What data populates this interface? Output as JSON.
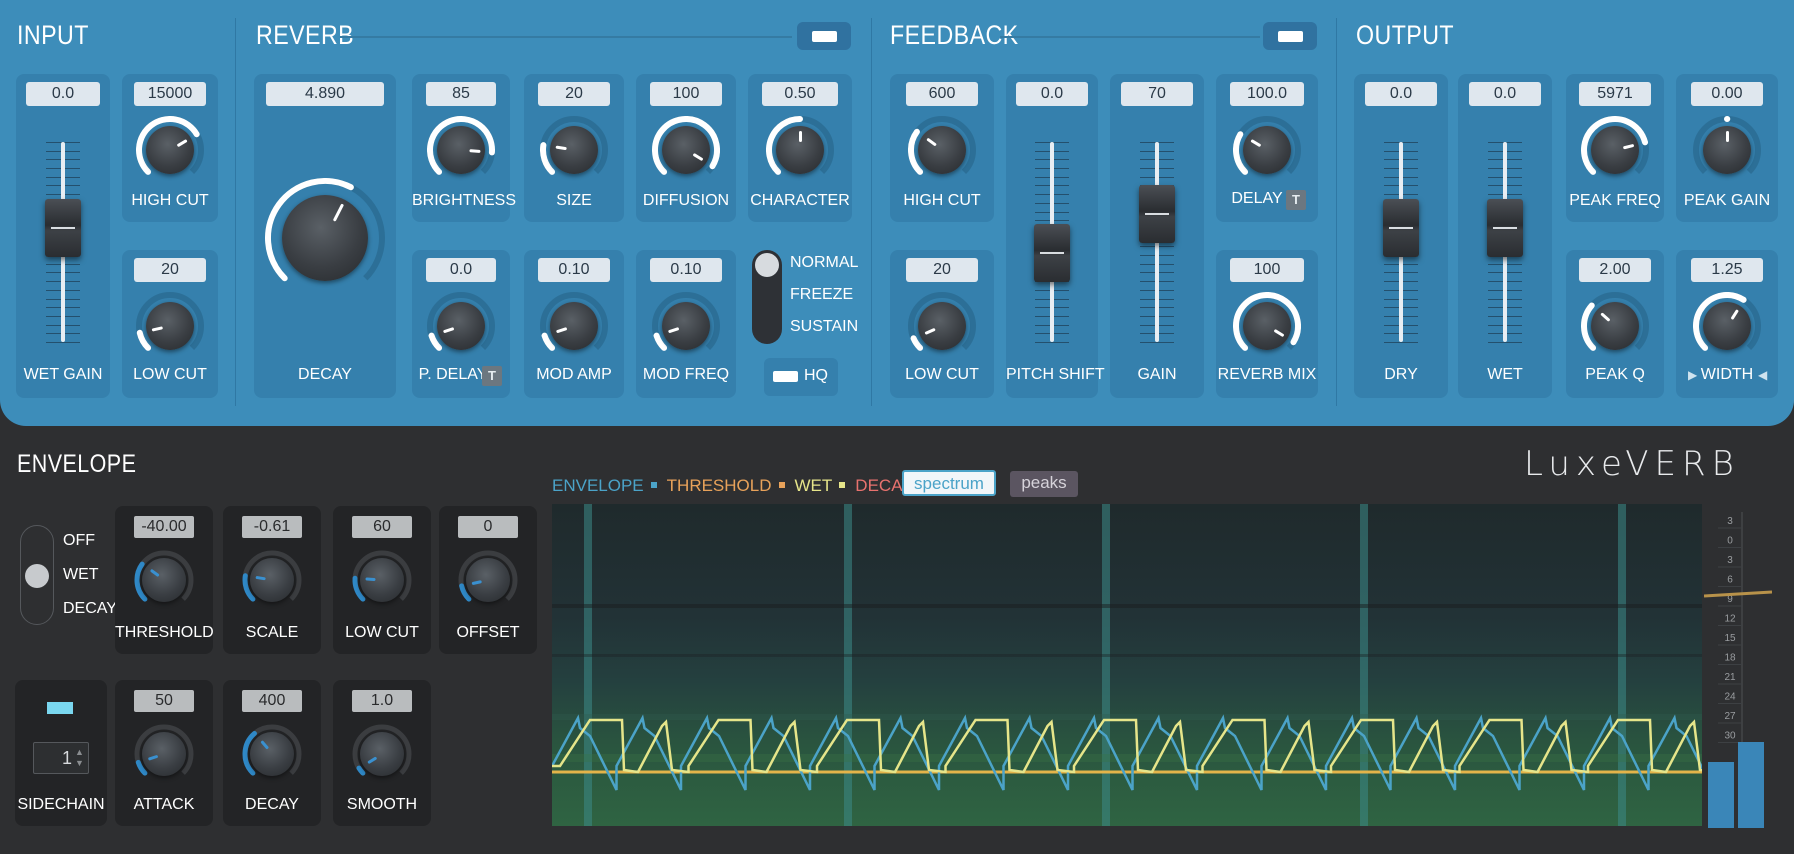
{
  "sections": {
    "input": {
      "title": "INPUT"
    },
    "reverb": {
      "title": "REVERB"
    },
    "feedback": {
      "title": "FEEDBACK"
    },
    "output": {
      "title": "OUTPUT"
    },
    "envelope": {
      "title": "ENVELOPE"
    }
  },
  "input": {
    "wet_gain": {
      "value": "0.0",
      "label": "WET GAIN"
    },
    "high_cut": {
      "value": "15000",
      "label": "HIGH CUT"
    },
    "low_cut": {
      "value": "20",
      "label": "LOW CUT"
    }
  },
  "reverb": {
    "decay": {
      "value": "4.890",
      "label": "DECAY"
    },
    "brightness": {
      "value": "85",
      "label": "BRIGHTNESS"
    },
    "size": {
      "value": "20",
      "label": "SIZE"
    },
    "diffusion": {
      "value": "100",
      "label": "DIFFUSION"
    },
    "character": {
      "value": "0.50",
      "label": "CHARACTER"
    },
    "p_delay": {
      "value": "0.0",
      "label": "P. DELAY",
      "sync": "T"
    },
    "mod_amp": {
      "value": "0.10",
      "label": "MOD AMP"
    },
    "mod_freq": {
      "value": "0.10",
      "label": "MOD FREQ"
    },
    "mode": {
      "options": [
        "NORMAL",
        "FREEZE",
        "SUSTAIN"
      ],
      "selected": "NORMAL"
    },
    "hq_label": "HQ"
  },
  "feedback": {
    "high_cut": {
      "value": "600",
      "label": "HIGH CUT"
    },
    "low_cut": {
      "value": "20",
      "label": "LOW CUT"
    },
    "pitch_shift": {
      "value": "0.0",
      "label": "PITCH SHIFT"
    },
    "gain": {
      "value": "70",
      "label": "GAIN"
    },
    "delay": {
      "value": "100.0",
      "label": "DELAY",
      "sync": "T"
    },
    "reverb_mix": {
      "value": "100",
      "label": "REVERB MIX"
    }
  },
  "output": {
    "dry": {
      "value": "0.0",
      "label": "DRY"
    },
    "wet": {
      "value": "0.0",
      "label": "WET"
    },
    "peak_freq": {
      "value": "5971",
      "label": "PEAK FREQ"
    },
    "peak_gain": {
      "value": "0.00",
      "label": "PEAK GAIN"
    },
    "peak_q": {
      "value": "2.00",
      "label": "PEAK Q"
    },
    "width": {
      "value": "1.25",
      "label": "WIDTH"
    }
  },
  "envelope": {
    "mode": {
      "options": [
        "OFF",
        "WET",
        "DECAY"
      ],
      "selected": "WET"
    },
    "threshold": {
      "value": "-40.00",
      "label": "THRESHOLD"
    },
    "scale": {
      "value": "-0.61",
      "label": "SCALE"
    },
    "low_cut": {
      "value": "60",
      "label": "LOW CUT"
    },
    "offset": {
      "value": "0",
      "label": "OFFSET"
    },
    "sidechain": {
      "value": "1",
      "label": "SIDECHAIN"
    },
    "attack": {
      "value": "50",
      "label": "ATTACK"
    },
    "decay": {
      "value": "400",
      "label": "DECAY"
    },
    "smooth": {
      "value": "1.0",
      "label": "SMOOTH"
    }
  },
  "brand": "LuxeVERB",
  "legend": [
    {
      "label": "ENVELOPE",
      "color": "#4ba3c8"
    },
    {
      "label": "THRESHOLD",
      "color": "#e8a25a"
    },
    {
      "label": "WET",
      "color": "#e6e58a"
    },
    {
      "label": "DECAY",
      "color": "#e8726e"
    }
  ],
  "view_buttons": {
    "spectrum": "spectrum",
    "peaks": "peaks",
    "active": "spectrum"
  },
  "meter_scale": [
    "3",
    "0",
    "3",
    "6",
    "9",
    "12",
    "15",
    "18",
    "21",
    "24",
    "27",
    "30"
  ],
  "colors": {
    "panel_blue": "#3d8dba",
    "dark_panel": "#2e2f31",
    "accent": "#4ba3c8"
  }
}
